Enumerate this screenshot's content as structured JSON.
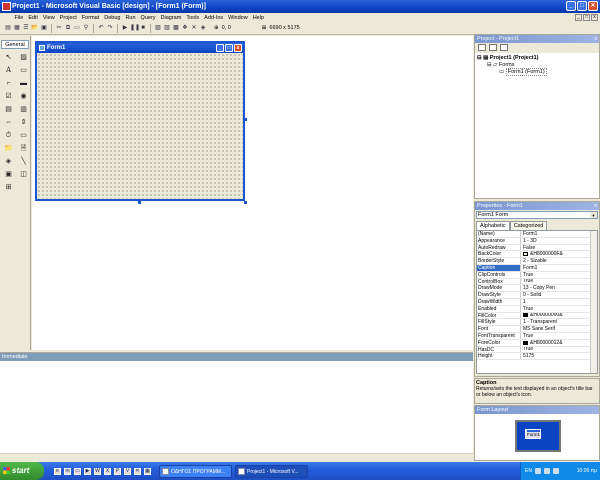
{
  "window": {
    "title": "Project1 - Microsoft Visual Basic [design] - [Form1 (Form)]"
  },
  "menu": [
    "File",
    "Edit",
    "View",
    "Project",
    "Format",
    "Debug",
    "Run",
    "Query",
    "Diagram",
    "Tools",
    "Add-Ins",
    "Window",
    "Help"
  ],
  "toolbar": {
    "position": "0, 0",
    "size": "6690 x 5175"
  },
  "toolbox": {
    "tab_label": "General"
  },
  "form": {
    "title": "Form1"
  },
  "immediate": {
    "title": "Immediate"
  },
  "project_explorer": {
    "title": "Project - Project1",
    "tree": [
      "Project1 (Project1)",
      "Forms",
      "Form1 (Form1)"
    ]
  },
  "properties": {
    "title": "Properties - Form1",
    "object": "Form1  Form",
    "tabs": [
      "Alphabetic",
      "Categorized"
    ],
    "rows": [
      {
        "name": "(Name)",
        "value": "Form1"
      },
      {
        "name": "Appearance",
        "value": "1 - 3D"
      },
      {
        "name": "AutoRedraw",
        "value": "False"
      },
      {
        "name": "BackColor",
        "value": "&H8000000F&",
        "swatch": "#ece9d8"
      },
      {
        "name": "BorderStyle",
        "value": "2 - Sizable"
      },
      {
        "name": "Caption",
        "value": "Form1",
        "selected": true
      },
      {
        "name": "ClipControls",
        "value": "True"
      },
      {
        "name": "ControlBox",
        "value": "True"
      },
      {
        "name": "DrawMode",
        "value": "13 - Copy Pen"
      },
      {
        "name": "DrawStyle",
        "value": "0 - Solid"
      },
      {
        "name": "DrawWidth",
        "value": "1"
      },
      {
        "name": "Enabled",
        "value": "True"
      },
      {
        "name": "FillColor",
        "value": "&H00000000&",
        "swatch": "#000000"
      },
      {
        "name": "FillStyle",
        "value": "1 - Transparent"
      },
      {
        "name": "Font",
        "value": "MS Sans Serif"
      },
      {
        "name": "FontTransparent",
        "value": "True"
      },
      {
        "name": "ForeColor",
        "value": "&H80000012&",
        "swatch": "#000000"
      },
      {
        "name": "HasDC",
        "value": "True"
      },
      {
        "name": "Height",
        "value": "5175"
      }
    ],
    "description_title": "Caption",
    "description_text": "Returns/sets the text displayed in an object's title bar or below an object's icon."
  },
  "form_layout": {
    "title": "Form Layout",
    "mini_label": "Form1"
  },
  "taskbar": {
    "start": "start",
    "tasks": [
      "ΟΔΗΓΟΣ ΠΡΟΓΡΑΜΜ...",
      "Project1 - Microsoft V..."
    ],
    "language": "EN",
    "clock": "10:06 πμ"
  }
}
